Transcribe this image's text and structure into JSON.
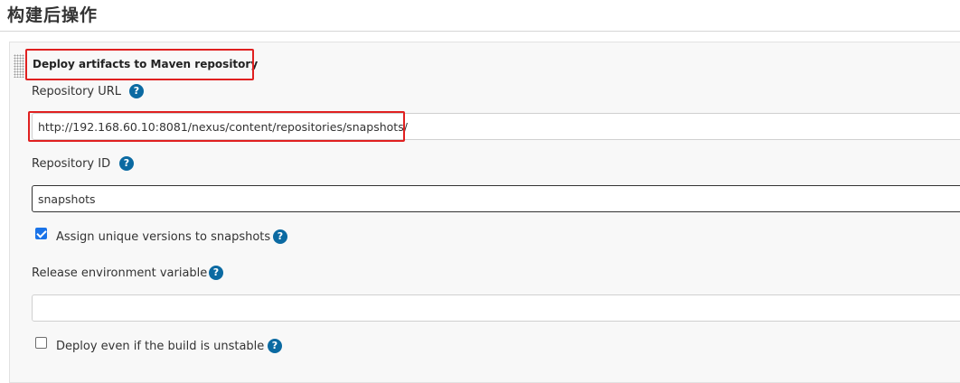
{
  "section": {
    "title": "构建后操作"
  },
  "panel": {
    "title": "Deploy artifacts to Maven repository",
    "help_icon_glyph": "?",
    "repository_url": {
      "label": "Repository URL",
      "value": "http://192.168.60.10:8081/nexus/content/repositories/snapshots/"
    },
    "repository_id": {
      "label": "Repository ID",
      "value": "snapshots"
    },
    "unique_versions": {
      "label": "Assign unique versions to snapshots",
      "checked": true
    },
    "release_env": {
      "label": "Release environment variable",
      "value": ""
    },
    "deploy_unstable": {
      "label": "Deploy even if the build is unstable",
      "checked": false
    }
  },
  "colors": {
    "highlight": "#e02020",
    "help_icon": "#0b6aa2",
    "checkbox_checked": "#1a73e8"
  }
}
